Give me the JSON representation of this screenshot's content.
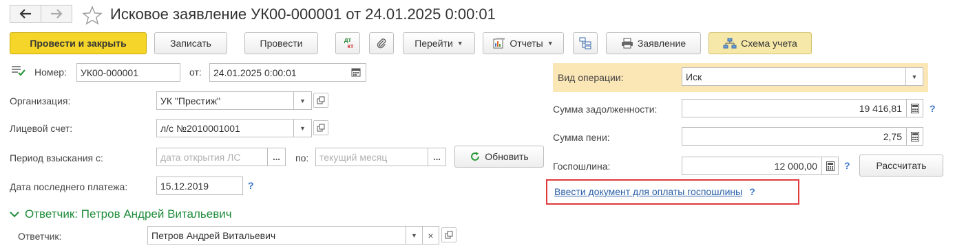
{
  "window": {
    "title": "Исковое заявление УК00-000001 от 24.01.2025 0:00:01"
  },
  "toolbar": {
    "post_close": "Провести и закрыть",
    "save": "Записать",
    "post": "Провести",
    "dtkt_dt": "дт",
    "dtkt_kt": "кт",
    "goto": "Перейти",
    "reports": "Отчеты",
    "statement": "Заявление",
    "schema": "Схема учета"
  },
  "header": {
    "number_label": "Номер:",
    "number_value": "УК00-000001",
    "from_label": "от:",
    "date_value": "24.01.2025  0:00:01"
  },
  "form": {
    "org_label": "Организация:",
    "org_value": "УК \"Престиж\"",
    "account_label": "Лицевой счет:",
    "account_value": "л/с №2010001001",
    "period_label": "Период взыскания с:",
    "period_from_placeholder": "дата открытия ЛС",
    "period_to_label": "по:",
    "period_to_placeholder": "текущий месяц",
    "refresh": "Обновить",
    "last_payment_label": "Дата последнего платежа:",
    "last_payment_value": "15.12.2019",
    "help": "?"
  },
  "right": {
    "operation_label": "Вид операции:",
    "operation_value": "Иск",
    "debt_label": "Сумма задолженности:",
    "debt_value": "19 416,81",
    "penalty_label": "Сумма пени:",
    "penalty_value": "2,75",
    "duty_label": "Госпошлина:",
    "duty_value": "12 000,00",
    "calculate": "Рассчитать",
    "duty_link": "Ввести документ для оплаты госпошлины"
  },
  "defendant": {
    "section_title": "Ответчик: Петров Андрей Витальевич",
    "label": "Ответчик:",
    "value": "Петров Андрей Витальевич"
  },
  "colors": {
    "primary_button": "#f5d52a",
    "highlight": "#fbe6b6",
    "link": "#2a5fa8",
    "section": "#1f8c3b",
    "callout": "#e03a3a"
  }
}
